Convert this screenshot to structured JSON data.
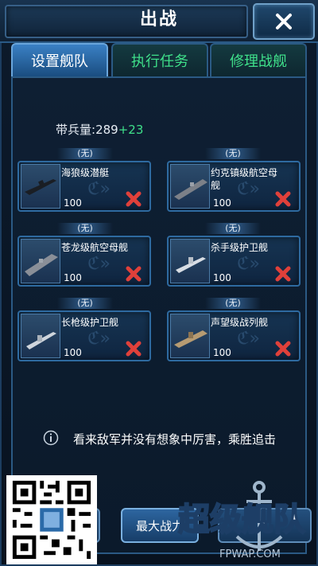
{
  "title": "出战",
  "close_label": "✕",
  "tabs": [
    {
      "label": "设置舰队",
      "active": true
    },
    {
      "label": "执行任务",
      "active": false
    },
    {
      "label": "修理战舰",
      "active": false
    }
  ],
  "troops": {
    "label": "带兵量:",
    "value": "289",
    "bonus": "+23"
  },
  "slot_tag": "(无)",
  "ships": [
    {
      "name": "海狼级潜艇",
      "level": "100",
      "icon": "submarine-icon"
    },
    {
      "name": "约克镇级航空母舰",
      "level": "100",
      "icon": "carrier-icon"
    },
    {
      "name": "苍龙级航空母舰",
      "level": "100",
      "icon": "carrier-icon"
    },
    {
      "name": "杀手级护卫舰",
      "level": "100",
      "icon": "frigate-icon"
    },
    {
      "name": "长枪级护卫舰",
      "level": "100",
      "icon": "frigate-icon"
    },
    {
      "name": "声望级战列舰",
      "level": "100",
      "icon": "battleship-icon"
    }
  ],
  "tip": "看来敌军并没有想象中厉害，乘胜追击",
  "buttons": {
    "max_power": "最大战力"
  },
  "logo": {
    "text": "超级舰队",
    "site": "FPWAP.COM"
  },
  "colors": {
    "accent_green": "#3fe08a",
    "remove_red": "#e0403a",
    "frame_blue": "#2b5a84"
  }
}
